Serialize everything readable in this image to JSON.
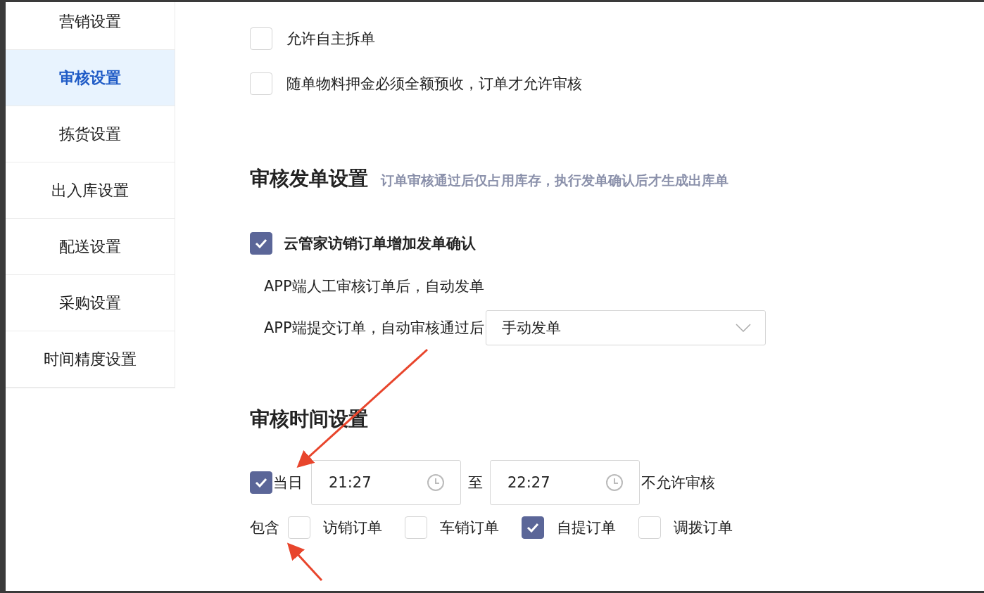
{
  "sidebar": {
    "items": [
      {
        "label": "营销设置",
        "selected": false
      },
      {
        "label": "审核设置",
        "selected": true
      },
      {
        "label": "拣货设置",
        "selected": false
      },
      {
        "label": "出入库设置",
        "selected": false
      },
      {
        "label": "配送设置",
        "selected": false
      },
      {
        "label": "采购设置",
        "selected": false
      },
      {
        "label": "时间精度设置",
        "selected": false
      }
    ]
  },
  "options": [
    {
      "label": "允许自主拆单",
      "checked": false
    },
    {
      "label": "随单物料押金必须全额预收，订单才允许审核",
      "checked": false
    }
  ],
  "dispatch_section": {
    "title": "审核发单设置",
    "subtitle": "订单审核通过后仅占用库存，执行发单确认后才生成出库单",
    "option": {
      "label": "云管家访销订单增加发单确认",
      "checked": true
    },
    "manual_audit_text": "APP端人工审核订单后，自动发单",
    "auto_audit": {
      "label": "APP端提交订单，自动审核通过后",
      "select_value": "手动发单"
    }
  },
  "time_section": {
    "title": "审核时间设置",
    "same_day": {
      "label": "当日",
      "checked": true
    },
    "start_time": "21:27",
    "separator": "至",
    "end_time": "22:27",
    "suffix": "不允许审核",
    "include_label": "包含",
    "order_types": [
      {
        "label": "访销订单",
        "checked": false
      },
      {
        "label": "车销订单",
        "checked": false
      },
      {
        "label": "自提订单",
        "checked": true
      },
      {
        "label": "调拨订单",
        "checked": false
      }
    ]
  }
}
